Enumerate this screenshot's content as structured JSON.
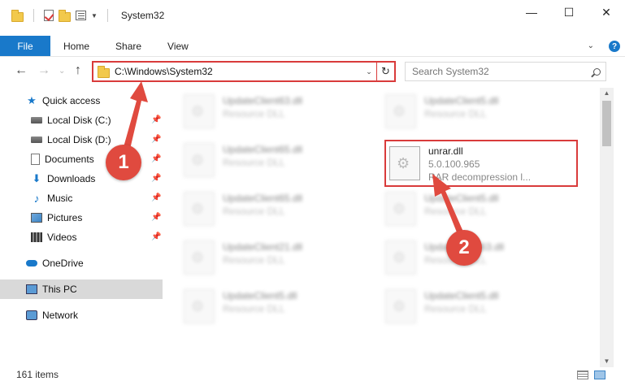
{
  "window": {
    "title": "System32",
    "minimize_glyph": "—",
    "maximize_glyph": "☐",
    "close_glyph": "✕"
  },
  "ribbon": {
    "tabs": [
      "File",
      "Home",
      "Share",
      "View"
    ],
    "help_glyph": "?"
  },
  "address": {
    "path": "C:\\Windows\\System32",
    "search_placeholder": "Search System32"
  },
  "nav_pane": {
    "quick_access": "Quick access",
    "items": [
      {
        "label": "Local Disk (C:)",
        "icon": "disk-icon"
      },
      {
        "label": "Local Disk (D:)",
        "icon": "disk-icon"
      },
      {
        "label": "Documents",
        "icon": "documents-icon"
      },
      {
        "label": "Downloads",
        "icon": "downloads-icon"
      },
      {
        "label": "Music",
        "icon": "music-icon"
      },
      {
        "label": "Pictures",
        "icon": "pictures-icon"
      },
      {
        "label": "Videos",
        "icon": "videos-icon"
      }
    ],
    "onedrive": "OneDrive",
    "this_pc": "This PC",
    "network": "Network"
  },
  "files": {
    "left_column": [
      {
        "name": "UpdateClient63.dll",
        "type": "Resource DLL"
      },
      {
        "name": "UpdateClient65.dll",
        "type": "Resource DLL"
      },
      {
        "name": "UpdateClient65.dll",
        "type": "Resource DLL"
      },
      {
        "name": "UpdateClient21.dll",
        "type": "Resource DLL"
      },
      {
        "name": "UpdateClient5.dll",
        "type": "Resource DLL"
      }
    ],
    "right_column": [
      {
        "name": "UpdateClient5.dll",
        "type": "Resource DLL"
      },
      {
        "name": "UpdateClient5.dll",
        "type": "Resource DLL"
      },
      {
        "name": "UpdateClient63.dll",
        "type": "Resource DLL"
      },
      {
        "name": "UpdateClient5.dll",
        "type": "Resource DLL"
      }
    ],
    "highlighted": {
      "name": "unrar.dll",
      "version": "5.0.100.965",
      "description": "RAR decompression l..."
    }
  },
  "status": {
    "item_count": "161 items"
  },
  "callouts": {
    "step1": "1",
    "step2": "2"
  },
  "colors": {
    "accent": "#1979ca",
    "annotation_red": "#d93b3b"
  }
}
